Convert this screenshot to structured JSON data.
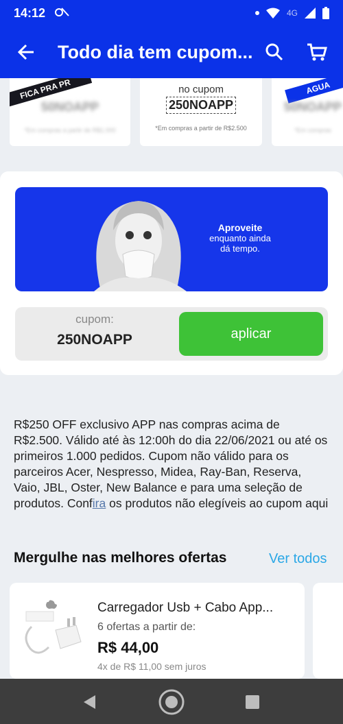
{
  "status_bar": {
    "time": "14:12",
    "network": "4G",
    "icons": [
      "notification-dot",
      "wifi-icon",
      "signal-icon",
      "battery-icon"
    ]
  },
  "app_bar": {
    "title": "Todo dia tem cupom...",
    "back_icon": "arrow-left-icon",
    "search_icon": "search-icon",
    "cart_icon": "cart-icon"
  },
  "coupon_carousel": [
    {
      "ribbon": "FICA PRA PR",
      "code": "50NOAPP",
      "terms": "*Em compras a partir de R$1.000",
      "blurred": true
    },
    {
      "pre_label": "no cupom",
      "code": "250NOAPP",
      "terms": "*Em compras a partir de R$2.500",
      "blurred": false
    },
    {
      "ribbon": "AGUA",
      "code": "50NOAPP",
      "terms": "*Em compras",
      "blurred": true
    }
  ],
  "promo_banner": {
    "line1": "Aproveite",
    "line2": "enquanto ainda",
    "line3": "dá tempo."
  },
  "coupon_box": {
    "label": "cupom:",
    "code": "250NOAPP",
    "apply_label": "aplicar"
  },
  "description": {
    "text": "R$250 OFF exclusivo APP nas compras acima de R$2.500. Válido até às 12:00h do dia 22/06/2021 ou até os primeiros 1.000 pedidos.  Cupom não válido para os parceiros Acer, Nespresso, Midea, Ray-Ban, Reserva, Vaio, JBL, Oster, New Balance e para uma seleção de produtos. Conf",
    "link": "ira",
    "text_after": " os produtos não elegíveis ao cupom aqui"
  },
  "offers_section": {
    "title": "Mergulhe nas melhores ofertas",
    "see_all": "Ver todos"
  },
  "product": {
    "name": "Carregador Usb + Cabo App...",
    "offers": "6 ofertas a partir de:",
    "price": "R$ 44,00",
    "installments": "4x de R$ 11,00 sem juros"
  },
  "colors": {
    "primary": "#0b32e8",
    "apply_green": "#3ec237",
    "link_blue": "#2aa7e6",
    "nav_bar": "#3d3d3d"
  }
}
